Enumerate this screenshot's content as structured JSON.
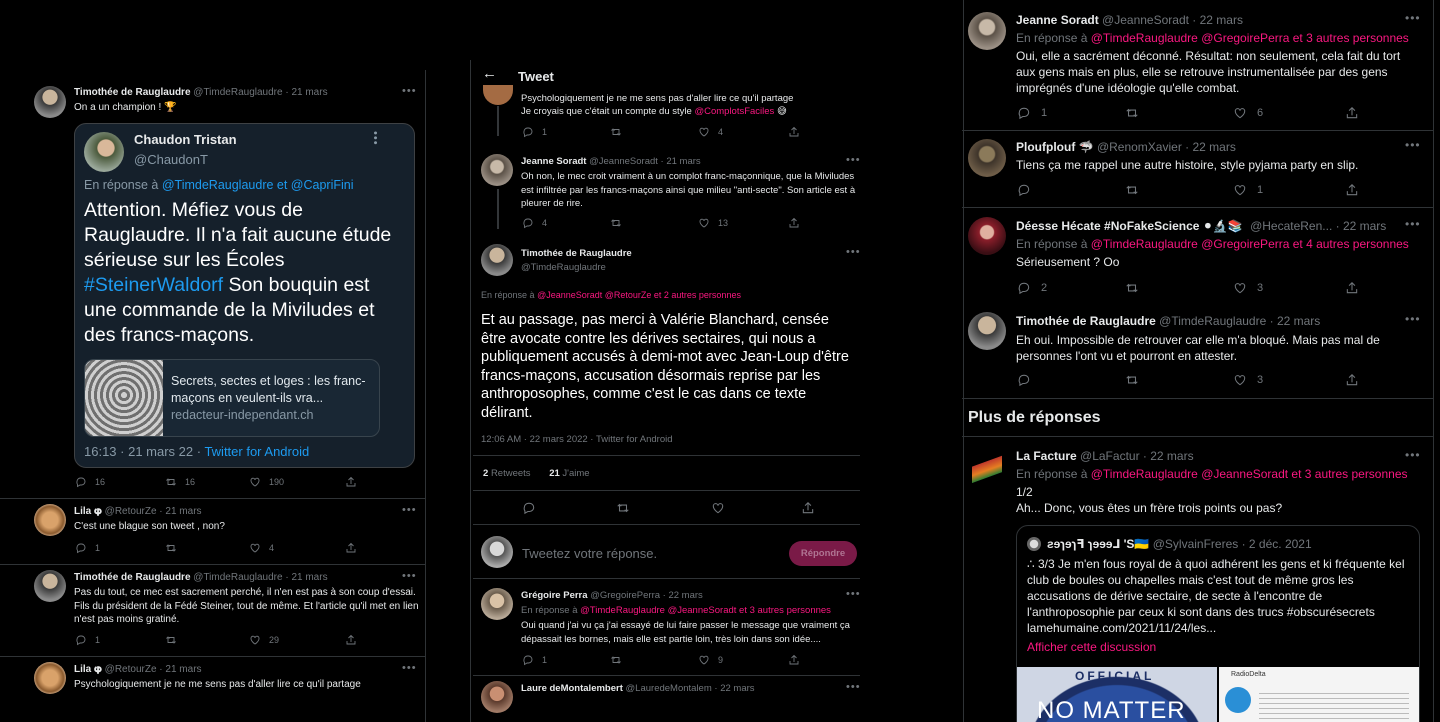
{
  "left": {
    "t1": {
      "name": "Timothée de Rauglaudre",
      "handle": "@TimdeRauglaudre · 21 mars",
      "text": "On a un champion ! 🏆",
      "quote": {
        "name": "Chaudon Tristan",
        "handle": "@ChaudonT",
        "reply_prefix": "En réponse à",
        "reply_to": "@TimdeRauglaudre et @CapriFini",
        "body_a": "Attention. Méfiez vous de Rauglaudre. Il n'a fait aucune étude sérieuse sur les Écoles ",
        "hashtag": "#SteinerWaldorf",
        "body_b": " Son bouquin est une commande de la Miviludes et des francs-maçons.",
        "card_title": "Secrets, sectes et loges : les franc-maçons en veulent-ils vra...",
        "card_domain": "redacteur-independant.ch",
        "time": "16:13 · 21 mars 22 · ",
        "source": "Twitter for Android"
      },
      "replies": "16",
      "retweets": "16",
      "likes": "190"
    },
    "t2": {
      "name": "Lila 𝛗",
      "handle": "@RetourZe · 21 mars",
      "text": "C'est une blague son tweet , non?",
      "replies": "1",
      "retweets": "",
      "likes": "4"
    },
    "t3": {
      "name": "Timothée de Rauglaudre",
      "handle": "@TimdeRauglaudre · 21 mars",
      "text": "Pas du tout, ce mec est sacrement perché, il n'en est pas à son coup d'essai. Fils du président de la Fédé Steiner, tout de même. Et l'article qu'il met en lien n'est pas moins gratiné.",
      "replies": "1",
      "retweets": "",
      "likes": "29"
    },
    "t4": {
      "name": "Lila 𝛗",
      "handle": "@RetourZe · 21 mars",
      "text": "Psychologiquement je ne me sens pas d'aller lire ce qu'il partage"
    }
  },
  "mid": {
    "header": "Tweet",
    "t0": {
      "text": "Psychologiquement je ne me sens pas d'aller lire ce qu'il partage",
      "text2": "Je croyais que c'était un compte du style ",
      "tag": "@ComplotsFaciles",
      "emoji": "😅",
      "replies": "1",
      "retweets": "",
      "likes": "4"
    },
    "t1": {
      "name": "Jeanne Soradt",
      "handle": "@JeanneSoradt · 21 mars",
      "text": "Oh non, le mec croit vraiment à un complot franc-maçonnique, que la Miviludes est infiltrée par les francs-maçons ainsi que milieu \"anti-secte\". Son article est à pleurer de rire.",
      "replies": "4",
      "retweets": "",
      "likes": "13"
    },
    "main": {
      "name": "Timothée de Rauglaudre",
      "handle": "@TimdeRauglaudre",
      "reply_prefix": "En réponse à",
      "reply_to": "@JeanneSoradt @RetourZe  et 2 autres personnes",
      "text": "Et au passage, pas merci à Valérie Blanchard, censée être avocate contre les dérives sectaires, qui nous a publiquement accusés à demi-mot avec Jean-Loup d'être francs-maçons, accusation désormais reprise par les anthroposophes, comme c'est le cas dans ce texte délirant.",
      "time": "12:06 AM · 22 mars 2022 · Twitter for Android",
      "retweets_n": "2",
      "retweets_l": "Retweets",
      "likes_n": "21",
      "likes_l": "J'aime"
    },
    "compose": {
      "placeholder": "Tweetez votre réponse.",
      "button": "Répondre"
    },
    "t2": {
      "name": "Grégoire Perra",
      "handle": "@GregoirePerra · 22 mars",
      "reply_prefix": "En réponse à",
      "reply_to": "@TimdeRauglaudre @JeanneSoradt  et 3 autres personnes",
      "text": "Oui quand j'ai vu ça j'ai essayé de lui faire passer le message que vraiment ça dépassait les bornes, mais elle est partie loin, très loin dans son idée....",
      "replies": "1",
      "retweets": "",
      "likes": "9"
    },
    "t3": {
      "name": "Laure deMontalembert",
      "handle": "@LauredeMontalem · 22 mars"
    }
  },
  "right": {
    "t1": {
      "name": "Jeanne Soradt",
      "handle": "@JeanneSoradt · 22 mars",
      "reply_prefix": "En réponse à",
      "reply_to": "@TimdeRauglaudre @GregoirePerra  et 3 autres personnes",
      "text": "Oui, elle a sacrément déconné. Résultat: non seulement, cela fait du tort aux gens mais en plus, elle se retrouve instrumentalisée par des gens imprégnés d'une idéologie qu'elle combat.",
      "replies": "1",
      "retweets": "",
      "likes": "6"
    },
    "t2": {
      "name": "Ploufplouf 🦈",
      "handle": "@RenomXavier · 22 mars",
      "text": "Tiens ça me rappel une autre histoire, style pyjama party en slip.",
      "replies": "",
      "retweets": "",
      "likes": "1"
    },
    "t3": {
      "name": "Déesse Hécate #NoFakeScience ⚫🔬📚",
      "handle": "@HecateRen... · 22 mars",
      "reply_prefix": "En réponse à",
      "reply_to": "@TimdeRauglaudre @GregoirePerra  et 4 autres personnes",
      "text": "Sérieusement ? Oo",
      "replies": "2",
      "retweets": "",
      "likes": "3"
    },
    "t4": {
      "name": "Timothée de Rauglaudre",
      "handle": "@TimdeRauglaudre · 22 mars",
      "text": "Eh oui. Impossible de retrouver car elle m'a bloqué. Mais pas mal de personnes l'ont vu et pourront en attester.",
      "replies": "",
      "retweets": "",
      "likes": "3"
    },
    "more": "Plus de réponses",
    "t5": {
      "name": "La Facture",
      "handle": "@LaFactur · 22 mars",
      "reply_prefix": "En réponse à",
      "reply_to": "@TimdeRauglaudre @JeanneSoradt  et 3 autres personnes",
      "line1": "1/2",
      "line2": "Ah... Donc, vous êtes un frère trois points ou pas?",
      "quote": {
        "name": "ƨɘɿɘɿꟻ ɿɘɘɘ⅃ 'S🇺🇦",
        "handle": "@SylvainFreres · 2 déc. 2021",
        "text": "∴ 3/3 Je m'en fous royal de à quoi adhérent les gens et ki fréquente kel club de boules ou chapelles mais c'est tout de même gros les accusations de dérive sectaire, de secte à l'encontre de l'anthroposophie par ceux ki sont dans des trucs #obscurésecrets lamehumaine.com/2021/11/24/les...",
        "link": "Afficher cette discussion",
        "img1": "NO MATTER",
        "img1b": "OFFICIAL",
        "img2": "RadioDelta"
      }
    }
  },
  "colors": {
    "pink": "#f91880",
    "blue": "#1d9bf0",
    "bg": "#000000",
    "border": "#2f3336",
    "muted": "#71767b"
  }
}
